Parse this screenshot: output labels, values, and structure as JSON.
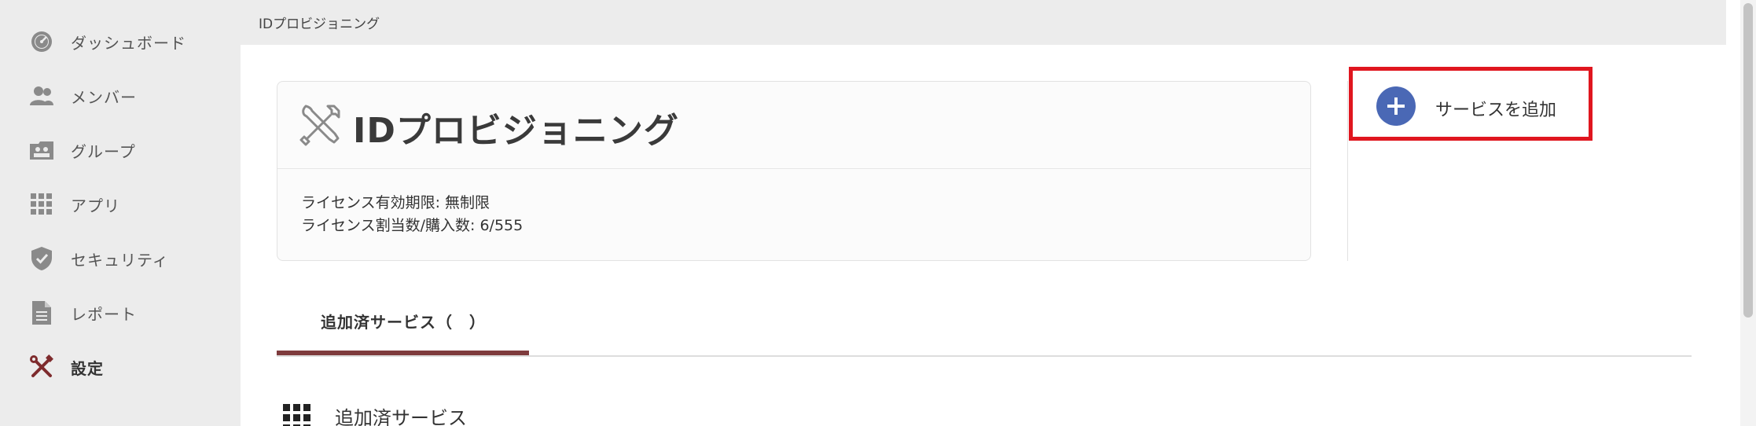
{
  "colors": {
    "sidebar_bg": "#ececec",
    "accent_red": "#e0161f",
    "plus_blue": "#4a68b5",
    "tab_underline": "#7e3b3d",
    "active_icon": "#7e2b2d"
  },
  "sidebar": {
    "items": [
      {
        "label": "ダッシュボード",
        "icon": "dashboard-gauge-icon"
      },
      {
        "label": "メンバー",
        "icon": "members-icon"
      },
      {
        "label": "グループ",
        "icon": "group-icon"
      },
      {
        "label": "アプリ",
        "icon": "apps-grid-icon"
      },
      {
        "label": "セキュリティ",
        "icon": "shield-check-icon"
      },
      {
        "label": "レポート",
        "icon": "report-document-icon"
      },
      {
        "label": "設定",
        "icon": "settings-tools-icon",
        "active": true
      }
    ]
  },
  "breadcrumb": "IDプロビジョニング",
  "card": {
    "title": "IDプロビジョニング",
    "icon": "tools-icon",
    "license_expiry": "ライセンス有効期限: 無制限",
    "license_count": "ライセンス割当数/購入数: 6/555"
  },
  "add_service": {
    "label": "サービスを追加",
    "icon": "plus-circle-icon"
  },
  "tabs": [
    {
      "label": "追加済サービス（　）",
      "active": true
    }
  ],
  "section": {
    "title": "追加済サービス",
    "icon": "grid-icon"
  }
}
